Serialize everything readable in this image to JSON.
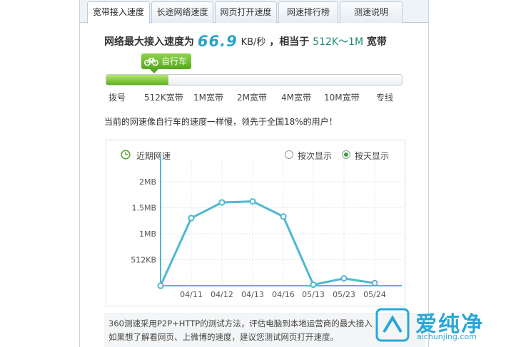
{
  "tabs": [
    {
      "label": "宽带接入速度",
      "active": true
    },
    {
      "label": "长途网络速度",
      "active": false
    },
    {
      "label": "网页打开速度",
      "active": false
    },
    {
      "label": "网速排行榜",
      "active": false
    },
    {
      "label": "测速说明",
      "active": false
    }
  ],
  "headline": {
    "prefix": "网络最大接入速度为",
    "speed": "66.9",
    "unit": "KB/秒",
    "middle": "，相当于",
    "range": "512K～1M",
    "suffix": "宽带"
  },
  "badge": {
    "label": "自行车",
    "icon": "bicycle-icon"
  },
  "speed_bar": {
    "fraction": 0.21
  },
  "scale_labels": [
    "拨号",
    "512K宽带",
    "1M宽带",
    "2M宽带",
    "4M宽带",
    "10M宽带",
    "专线"
  ],
  "status_text": "当前的网速像自行车的速度一样慢，领先于全国18%的用户！",
  "history": {
    "title": "近期网速",
    "options": [
      {
        "label": "按次显示",
        "selected": false
      },
      {
        "label": "按天显示",
        "selected": true
      }
    ]
  },
  "chart_data": {
    "type": "line",
    "categories": [
      "",
      "04/11",
      "04/12",
      "04/13",
      "04/16",
      "05/13",
      "05/23",
      "05/24"
    ],
    "values": [
      0,
      1.3,
      1.6,
      1.62,
      1.33,
      0.02,
      0.14,
      0.05
    ],
    "ytick_labels": [
      "512KB",
      "1MB",
      "1.5MB",
      "2MB"
    ],
    "yticks": [
      0.5,
      1.0,
      1.5,
      2.0
    ],
    "ylim": [
      0,
      2.3
    ],
    "grid": true,
    "line_color": "#4fb8d0"
  },
  "note": {
    "line1": "360测速采用P2P+HTTP的测试方法，评估电脑到本地运营商的最大接入",
    "line2": "如果想了解看网页、上微博的速度，建议您测试网页打开速度。"
  },
  "watermark": {
    "name": "爱纯净",
    "domain": "aichunjing.com"
  }
}
